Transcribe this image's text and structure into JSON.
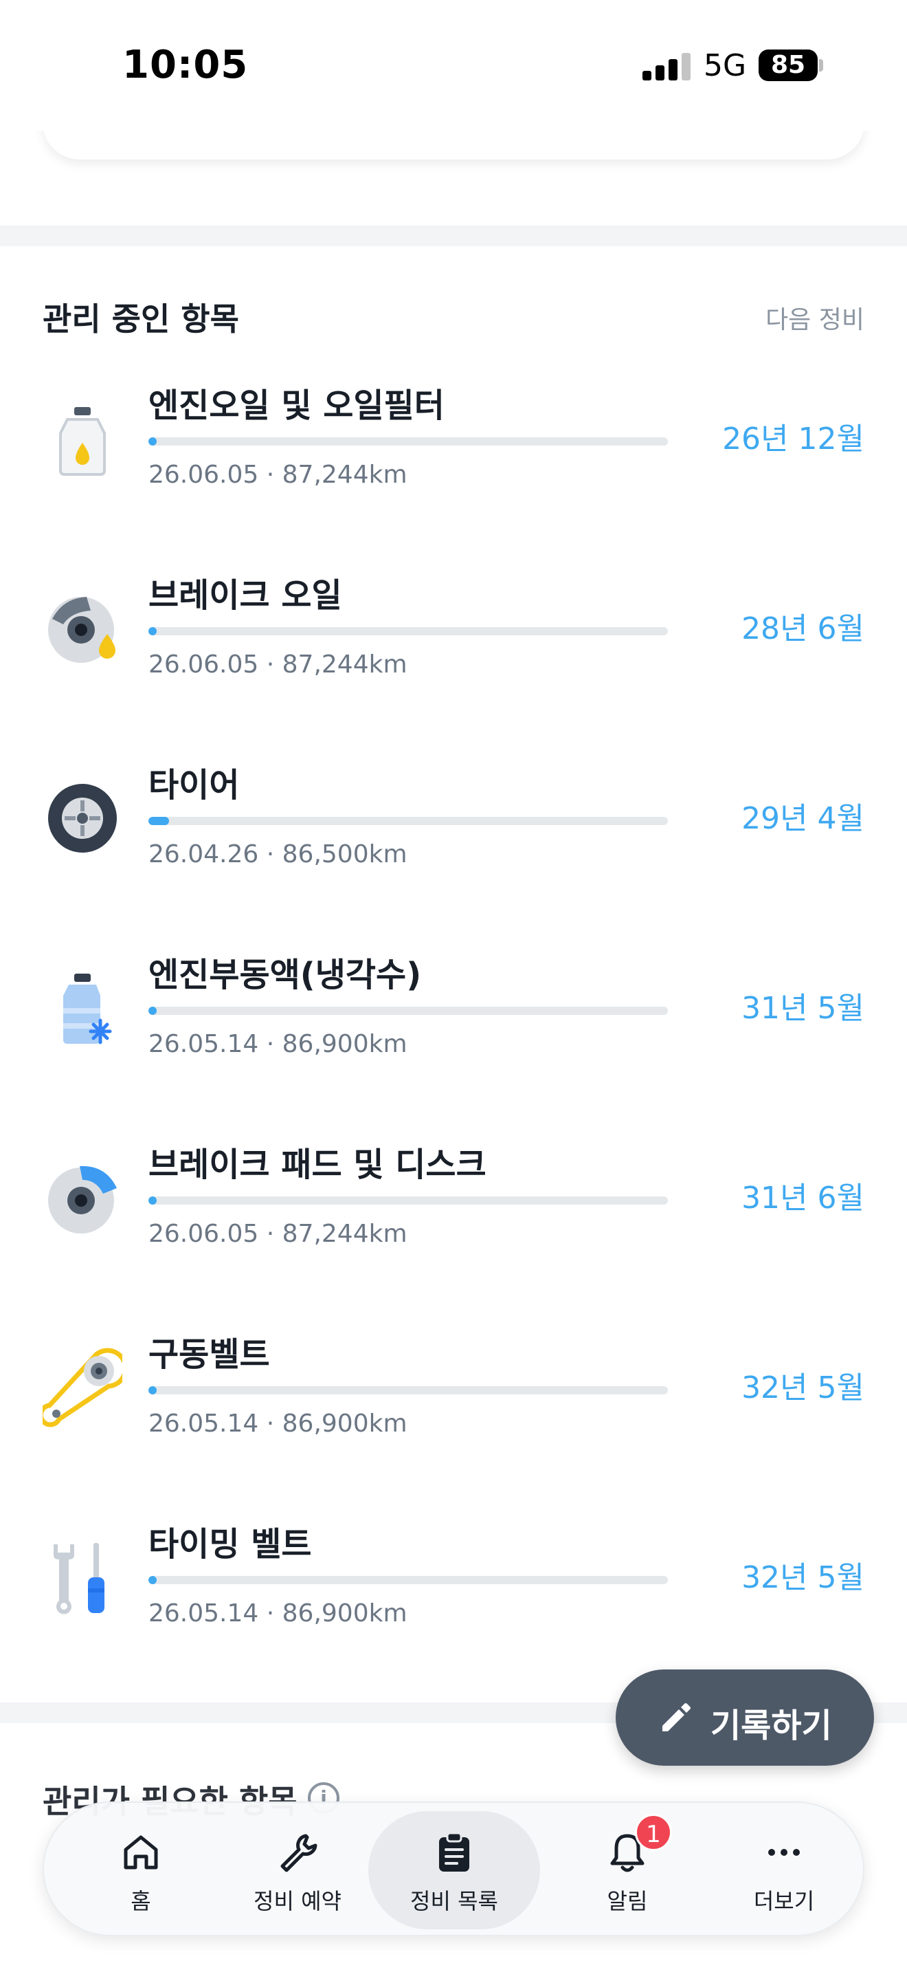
{
  "status_bar": {
    "time": "10:05",
    "network": "5G",
    "battery": "85"
  },
  "managed_section": {
    "title": "관리 중인 항목",
    "link": "다음 정비"
  },
  "items": [
    {
      "icon": "engine-oil-icon",
      "name": "엔진오일 및 오일필터",
      "meta": "26.06.05 · 87,244km",
      "next": "26년 12월",
      "progress": 0.01
    },
    {
      "icon": "brake-oil-icon",
      "name": "브레이크 오일",
      "meta": "26.06.05 · 87,244km",
      "next": "28년 6월",
      "progress": 0.0
    },
    {
      "icon": "tire-icon",
      "name": "타이어",
      "meta": "26.04.26 · 86,500km",
      "next": "29년 4월",
      "progress": 0.04
    },
    {
      "icon": "coolant-icon",
      "name": "엔진부동액(냉각수)",
      "meta": "26.05.14 · 86,900km",
      "next": "31년 5월",
      "progress": 0.01
    },
    {
      "icon": "brake-pad-icon",
      "name": "브레이크 패드 및 디스크",
      "meta": "26.06.05 · 87,244km",
      "next": "31년 6월",
      "progress": 0.0
    },
    {
      "icon": "drive-belt-icon",
      "name": "구동벨트",
      "meta": "26.05.14 · 86,900km",
      "next": "32년 5월",
      "progress": 0.01
    },
    {
      "icon": "timing-belt-icon",
      "name": "타이밍 벨트",
      "meta": "26.05.14 · 86,900km",
      "next": "32년 5월",
      "progress": 0.01
    }
  ],
  "needed_section": {
    "title": "관리가 필요한 항목"
  },
  "fab": {
    "label": "기록하기"
  },
  "nav": {
    "home": "홈",
    "booking": "정비 예약",
    "records": "정비 목록",
    "alerts": "알림",
    "alerts_badge": "1",
    "more": "더보기"
  },
  "colors": {
    "accent": "#3ea8f0",
    "badge": "#f04452",
    "fab": "#4e5968"
  }
}
